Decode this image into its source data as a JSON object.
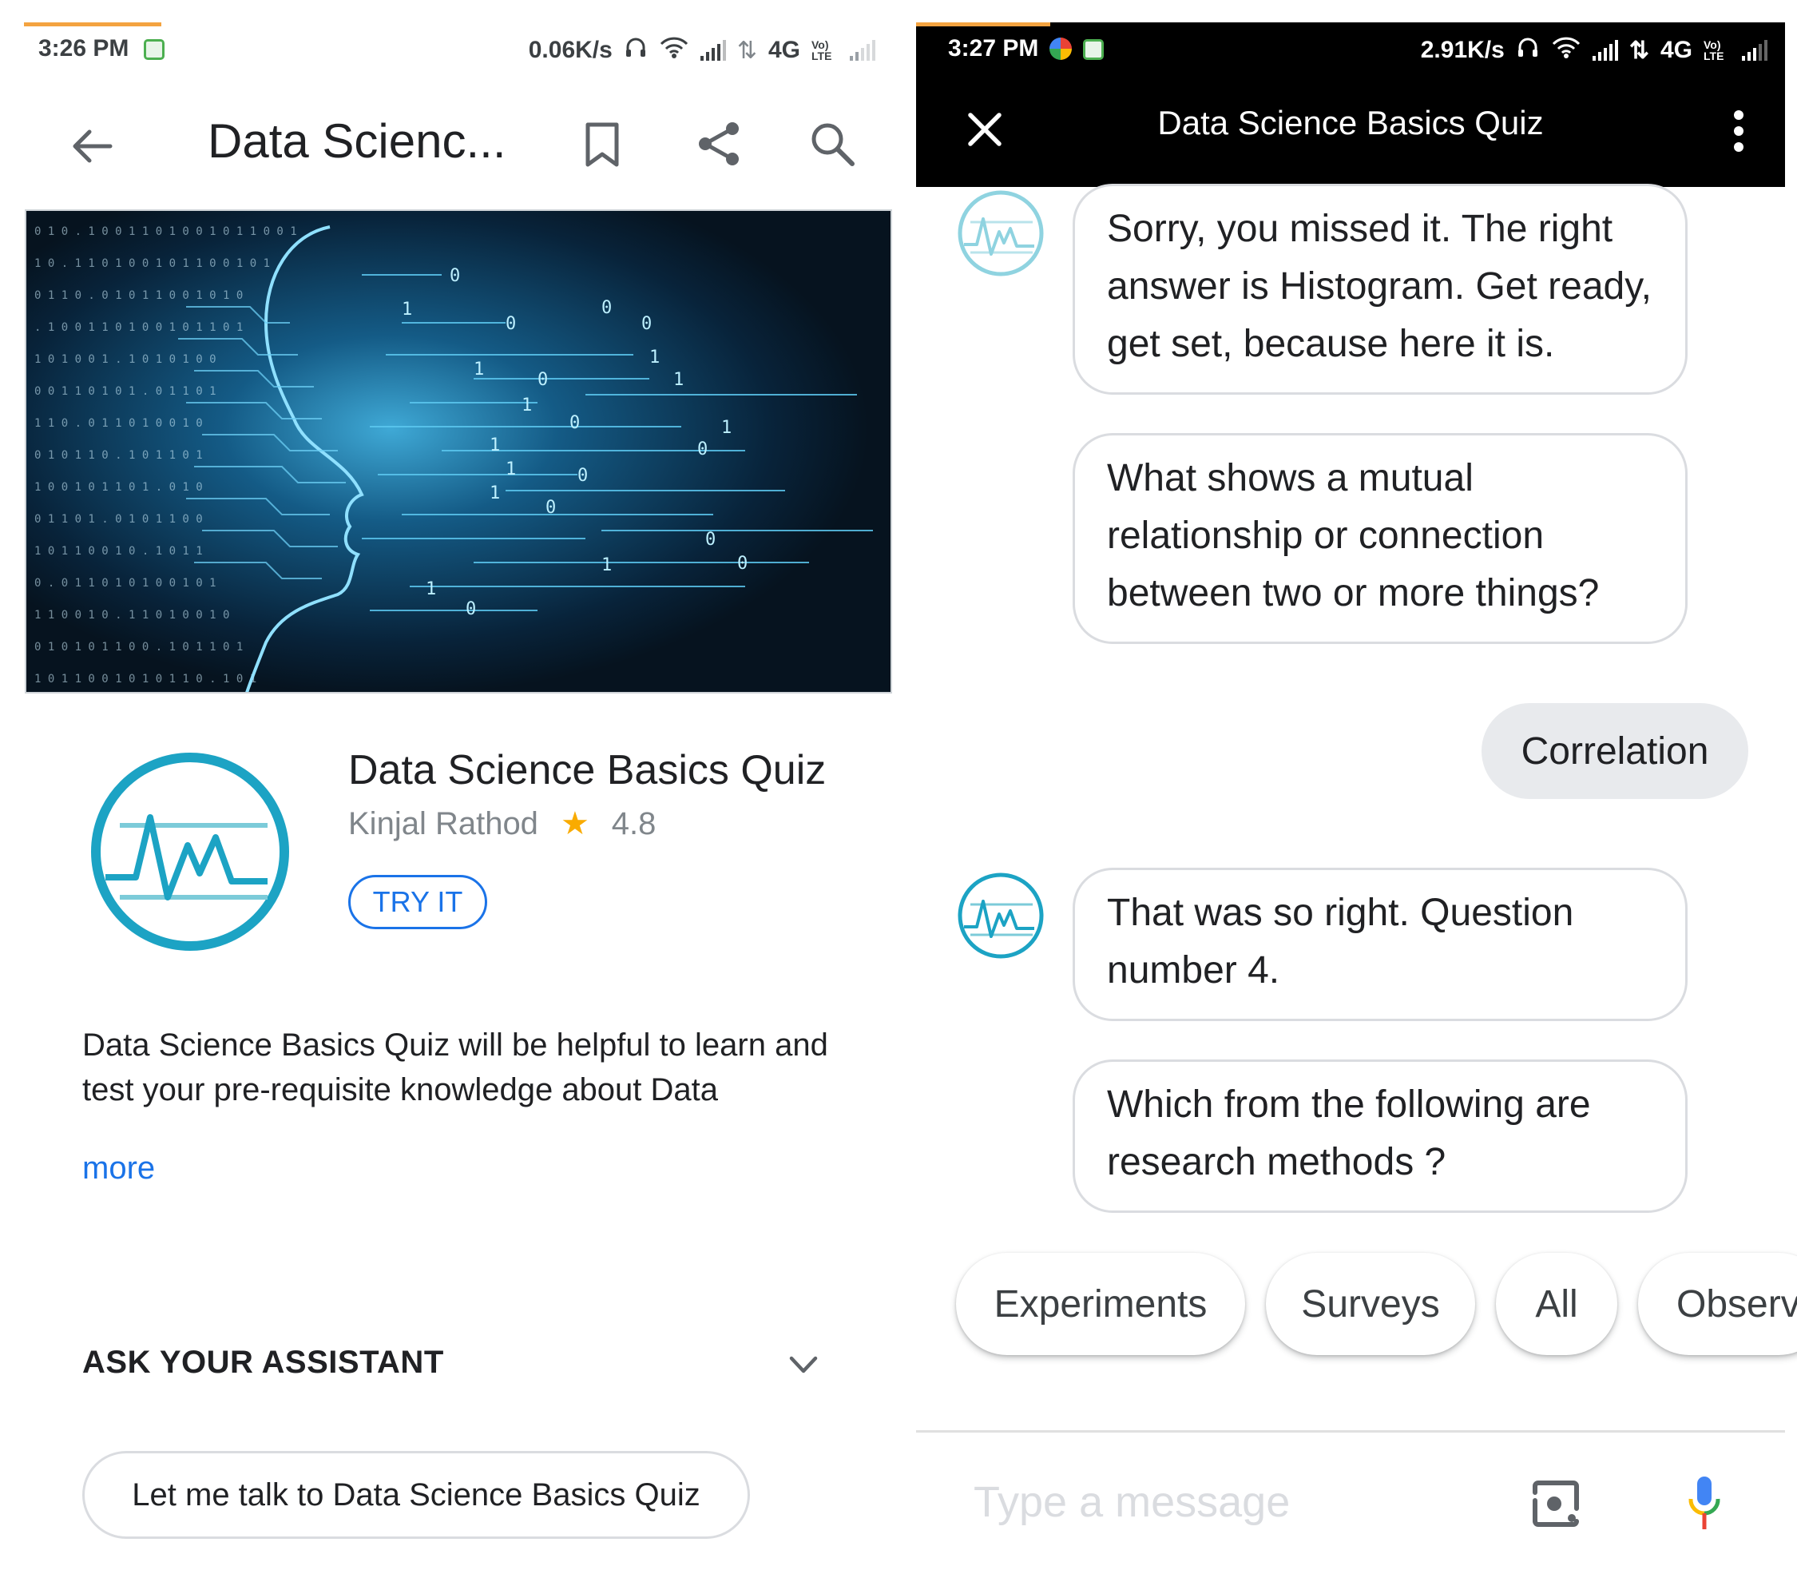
{
  "left": {
    "status": {
      "time": "3:26 PM",
      "net_speed": "0.06K/s",
      "network": "4G",
      "volte": "Vo) LTE"
    },
    "appbar": {
      "title": "Data Scienc...",
      "icons": [
        "back-arrow-icon",
        "bookmark-icon",
        "share-icon",
        "search-icon"
      ]
    },
    "app": {
      "name": "Data Science Basics Quiz",
      "developer": "Kinjal Rathod",
      "rating": "4.8",
      "try_label": "TRY IT"
    },
    "description": "Data Science Basics Quiz will be helpful to learn and test your pre-requisite knowledge about Data",
    "more_label": "more",
    "ask_assistant": {
      "heading": "ASK YOUR ASSISTANT",
      "chip": "Let me talk to Data Science Basics Quiz"
    }
  },
  "right": {
    "status": {
      "time": "3:27 PM",
      "net_speed": "2.91K/s",
      "network": "4G",
      "volte": "Vo) LTE"
    },
    "appbar": {
      "title": "Data Science Basics Quiz",
      "icons": [
        "close-icon",
        "more-vert-icon"
      ]
    },
    "messages": [
      {
        "from": "bot",
        "text": "Sorry, you missed it. The right answer is Histogram. Get ready, get set, because here it is."
      },
      {
        "from": "bot",
        "text": "What shows a mutual relationship or connection between two or more things?"
      },
      {
        "from": "user",
        "text": "Correlation"
      },
      {
        "from": "bot",
        "text": "That was so right. Question number 4."
      },
      {
        "from": "bot",
        "text": "Which from the following are research methods ?"
      }
    ],
    "suggestions": [
      "Experiments",
      "Surveys",
      "All",
      "Observ"
    ],
    "input": {
      "placeholder": "Type a message"
    },
    "colors": {
      "accent": "#1a73e8",
      "brand_teal": "#1ca3c4",
      "star": "#f9ab00"
    }
  }
}
